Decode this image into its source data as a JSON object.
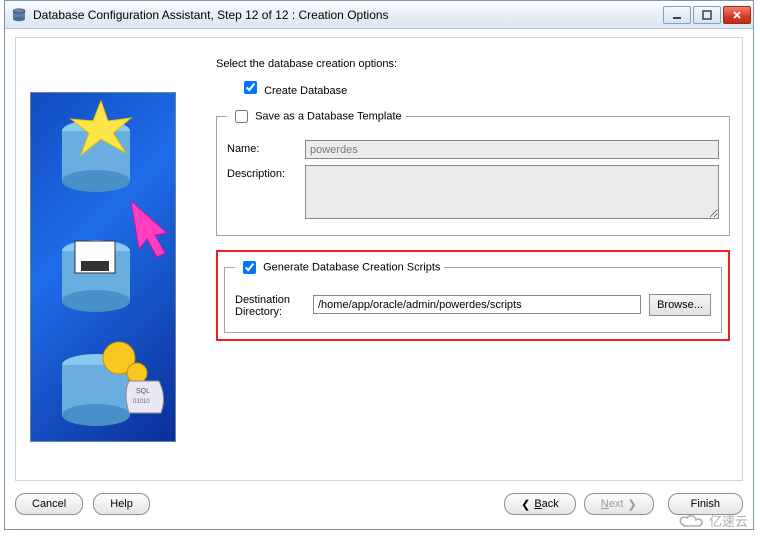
{
  "window": {
    "title": "Database Configuration Assistant, Step 12 of 12 : Creation Options"
  },
  "prompt": "Select the database creation options:",
  "createDb": {
    "label": "Create Database",
    "checked": true
  },
  "template": {
    "legend": "Save as a Database Template",
    "checked": false,
    "nameLabel": "Name:",
    "nameValue": "powerdes",
    "descLabel": "Description:",
    "descValue": ""
  },
  "scripts": {
    "legend": "Generate Database Creation Scripts",
    "checked": true,
    "destLabel": "Destination Directory:",
    "destValue": "/home/app/oracle/admin/powerdes/scripts",
    "browse": "Browse..."
  },
  "buttons": {
    "cancel": "Cancel",
    "help": "Help",
    "back": "Back",
    "next": "Next",
    "finish": "Finish"
  },
  "watermark": "亿速云"
}
